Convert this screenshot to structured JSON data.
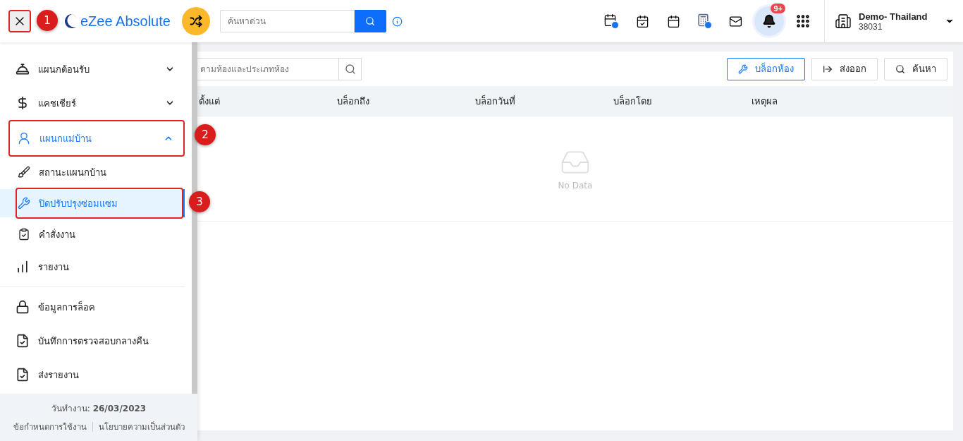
{
  "header": {
    "close_annotation": "1",
    "logo_text": "eZee Absolute",
    "search": {
      "placeholder": "ค้นหาด่วน"
    },
    "notification_badge": "9+",
    "property": {
      "name": "Demo- Thailand",
      "code": "38031"
    }
  },
  "sidebar": {
    "sections": [
      [
        {
          "label": "แผนกต้อนรับ",
          "kind": "group",
          "expanded": false,
          "selected": false
        },
        {
          "label": "แคชเชียร์",
          "kind": "group",
          "expanded": false,
          "selected": false
        },
        {
          "label": "แผนกแม่บ้าน",
          "kind": "group",
          "expanded": true,
          "selected": true,
          "annotation": "2",
          "children": [
            {
              "label": "สถานะแผนกบ้าน",
              "selected": false
            },
            {
              "label": "ปิดปรับปรุงซ่อมแซม",
              "selected": true,
              "annotation": "3"
            },
            {
              "label": "คำสั่งงาน",
              "selected": false
            }
          ]
        },
        {
          "label": "รายงาน",
          "kind": "link",
          "selected": false
        }
      ],
      [
        {
          "label": "ข้อมูลการล็อค",
          "kind": "link",
          "selected": false
        },
        {
          "label": "บันทึกการตรวจสอบกลางคืน",
          "kind": "link",
          "selected": false
        },
        {
          "label": "ส่งรายงาน",
          "kind": "link",
          "selected": false
        }
      ]
    ],
    "footer": {
      "work_date": "วันทำงาน: **26/03/2023**",
      "links": [
        "ข้อกำหนดการใช้งาน",
        "นโยบายความเป็นส่วนตัว"
      ]
    }
  },
  "content": {
    "search": {
      "placeholder": "ตามห้องและประเภทห้อง"
    },
    "buttons": [
      {
        "label": "บล็อกห้อง",
        "kind": "primary"
      },
      {
        "label": "ส่งออก",
        "kind": "export"
      },
      {
        "label": "ค้นหา",
        "kind": "search"
      }
    ],
    "table": {
      "columns": [
        "ตั้งแต่",
        "บล็อกถึง",
        "บล็อกวันที่",
        "บล็อกโดย",
        "เหตุผล"
      ],
      "empty_text": "No Data"
    }
  }
}
